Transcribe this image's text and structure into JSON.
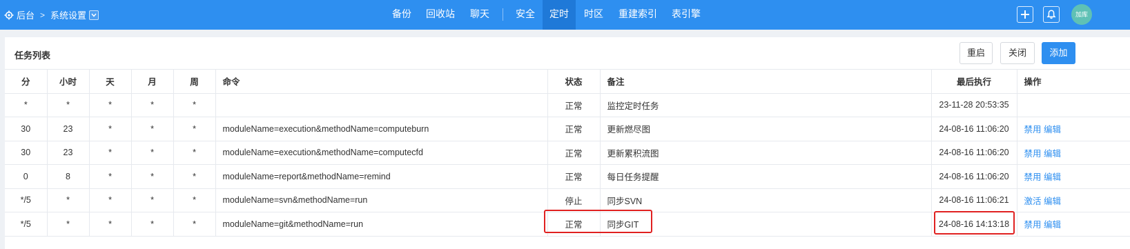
{
  "topbar": {
    "breadcrumb_root": "后台",
    "breadcrumb_separator": ">",
    "breadcrumb_current": "系统设置",
    "nav": [
      {
        "label": "备份",
        "active": false
      },
      {
        "label": "回收站",
        "active": false
      },
      {
        "label": "聊天",
        "active": false
      },
      {
        "label": "安全",
        "active": false
      },
      {
        "label": "定时",
        "active": true
      },
      {
        "label": "时区",
        "active": false
      },
      {
        "label": "重建索引",
        "active": false
      },
      {
        "label": "表引擎",
        "active": false
      }
    ],
    "avatar_text": "加库",
    "icons": {
      "settings": "gear-icon",
      "add": "plus-icon",
      "notifications": "bell-icon",
      "dropdown": "chevron-down-icon"
    }
  },
  "panel": {
    "title": "任务列表",
    "buttons": {
      "restart": "重启",
      "close": "关闭",
      "add": "添加"
    }
  },
  "table": {
    "columns": [
      "分",
      "小时",
      "天",
      "月",
      "周",
      "命令",
      "状态",
      "备注",
      "最后执行",
      "操作"
    ],
    "rows": [
      {
        "min": "*",
        "hour": "*",
        "day": "*",
        "month": "*",
        "week": "*",
        "command": "",
        "status": "正常",
        "note": "监控定时任务",
        "last_run": "23-11-28 20:53:35",
        "action1": "",
        "action2": ""
      },
      {
        "min": "30",
        "hour": "23",
        "day": "*",
        "month": "*",
        "week": "*",
        "command": "moduleName=execution&methodName=computeburn",
        "status": "正常",
        "note": "更新燃尽图",
        "last_run": "24-08-16 11:06:20",
        "action1": "禁用",
        "action2": "编辑"
      },
      {
        "min": "30",
        "hour": "23",
        "day": "*",
        "month": "*",
        "week": "*",
        "command": "moduleName=execution&methodName=computecfd",
        "status": "正常",
        "note": "更新累积流图",
        "last_run": "24-08-16 11:06:20",
        "action1": "禁用",
        "action2": "编辑"
      },
      {
        "min": "0",
        "hour": "8",
        "day": "*",
        "month": "*",
        "week": "*",
        "command": "moduleName=report&methodName=remind",
        "status": "正常",
        "note": "每日任务提醒",
        "last_run": "24-08-16 11:06:20",
        "action1": "禁用",
        "action2": "编辑"
      },
      {
        "min": "*/5",
        "hour": "*",
        "day": "*",
        "month": "*",
        "week": "*",
        "command": "moduleName=svn&methodName=run",
        "status": "停止",
        "note": "同步SVN",
        "last_run": "24-08-16 11:06:21",
        "action1": "激活",
        "action2": "编辑"
      },
      {
        "min": "*/5",
        "hour": "*",
        "day": "*",
        "month": "*",
        "week": "*",
        "command": "moduleName=git&methodName=run",
        "status": "正常",
        "note": "同步GIT",
        "last_run": "24-08-16 14:13:18",
        "action1": "禁用",
        "action2": "编辑"
      }
    ]
  },
  "colors": {
    "header_blue": "#2e8ff0",
    "active_nav": "#1f79d8",
    "link": "#2e8ff0",
    "highlight": "#e02020"
  }
}
